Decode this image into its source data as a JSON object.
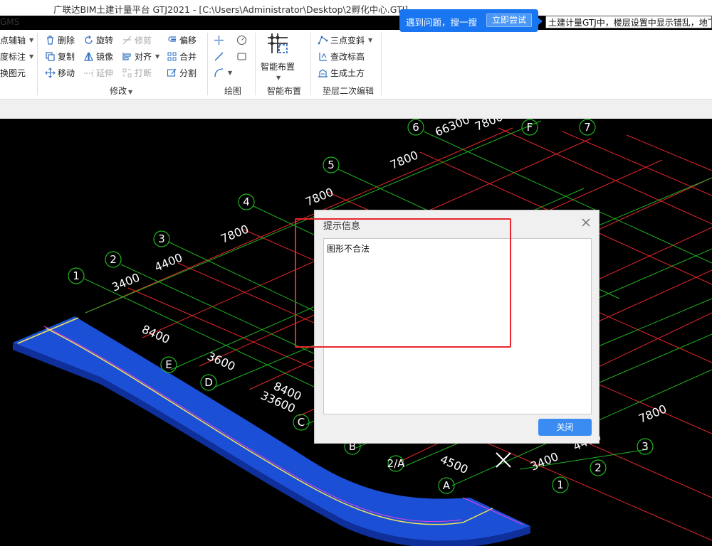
{
  "window": {
    "title": "广联达BIM土建计量平台 GTJ2021 - [C:\\Users\\Administrator\\Desktop\\2孵化中心.GTJ]",
    "gms": "GMS"
  },
  "search": {
    "prompt": "遇到问题，搜一搜",
    "button": "立即尝试",
    "query": "土建计量GTJ中，楼层设置中显示错乱，地下"
  },
  "ribbon": {
    "left_col": [
      "点辅轴",
      "度标注",
      "换图元"
    ],
    "modify": {
      "row1": [
        "删除",
        "旋转",
        "修剪",
        "偏移"
      ],
      "row2": [
        "复制",
        "镜像",
        "对齐",
        "合并"
      ],
      "row3": [
        "移动",
        "延伸",
        "打断",
        "分割"
      ],
      "group_label": "修改"
    },
    "draw": {
      "group_label": "绘图"
    },
    "smart": {
      "button": "智能布置",
      "group_label": "智能布置"
    },
    "cushion": {
      "items": [
        "三点变斜",
        "查改标高",
        "生成土方"
      ],
      "group_label": "垫层二次编辑"
    }
  },
  "canvas": {
    "axis_nums": [
      "1",
      "2",
      "3",
      "4",
      "5",
      "6",
      "7"
    ],
    "axis_letters": [
      "A",
      "2/A",
      "B",
      "C",
      "D",
      "E",
      "F"
    ],
    "dims_top": [
      "3400",
      "4400",
      "7800",
      "7800",
      "7800",
      "66300",
      "7800"
    ],
    "dims_left": [
      "8400",
      "3600",
      "8400",
      "33600"
    ],
    "dims_bottom": [
      "4500",
      "3400",
      "4400",
      "7800"
    ],
    "bottom_nums": [
      "1",
      "2",
      "3"
    ]
  },
  "dialog": {
    "title": "提示信息",
    "message": "图形不合法",
    "close_button": "关闭"
  },
  "colors": {
    "grid_red": "#e8262a",
    "grid_green": "#21b521",
    "slab_blue": "#1b4fd6",
    "accent_blue": "#1976f0"
  }
}
